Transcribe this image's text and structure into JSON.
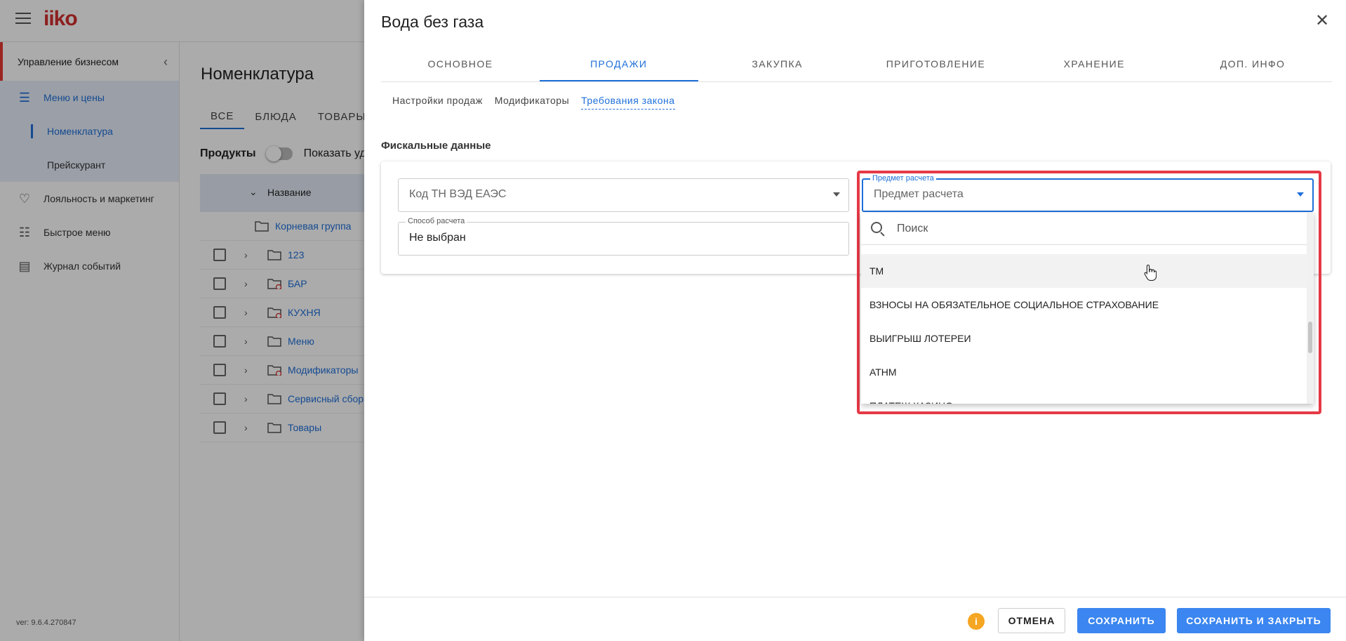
{
  "app": {
    "logo": "iiko",
    "version": "ver: 9.6.4.270847"
  },
  "sidebar": {
    "header": "Управление бизнесом",
    "items": [
      {
        "label": "Меню и цены",
        "icon": "menu-list-icon"
      },
      {
        "label": "Номенклатура"
      },
      {
        "label": "Прейскурант"
      },
      {
        "label": "Лояльность и маркетинг",
        "icon": "heart-icon"
      },
      {
        "label": "Быстрое меню",
        "icon": "quick-menu-icon"
      },
      {
        "label": "Журнал событий",
        "icon": "event-log-icon"
      }
    ]
  },
  "main": {
    "title": "Номенклатура",
    "tabs": [
      "ВСЕ",
      "БЛЮДА",
      "ТОВАРЫ"
    ],
    "products_label": "Продукты",
    "show_deleted_label": "Показать уд",
    "column_name": "Название",
    "root_group": "Корневая группа",
    "tree": [
      {
        "label": "123",
        "warn": false
      },
      {
        "label": "БАР",
        "warn": true
      },
      {
        "label": "КУХНЯ",
        "warn": true
      },
      {
        "label": "Меню",
        "warn": false
      },
      {
        "label": "Модификаторы",
        "warn": true
      },
      {
        "label": "Сервисный сбор",
        "warn": false
      },
      {
        "label": "Товары",
        "warn": false
      }
    ]
  },
  "drawer": {
    "title": "Вода без газа",
    "tabs": [
      "ОСНОВНОЕ",
      "ПРОДАЖИ",
      "ЗАКУПКА",
      "ПРИГОТОВЛЕНИЕ",
      "ХРАНЕНИЕ",
      "ДОП. ИНФО"
    ],
    "active_tab": "ПРОДАЖИ",
    "sub_tabs": [
      "Настройки продаж",
      "Модификаторы",
      "Требования закона"
    ],
    "active_sub_tab": "Требования закона",
    "section_title": "Фискальные данные",
    "fields": {
      "tnved": {
        "placeholder": "Код ТН ВЭД ЕАЭС"
      },
      "payment_method": {
        "label": "Способ расчета",
        "value": "Не выбран"
      },
      "payment_subject": {
        "label": "Предмет расчета",
        "value": "Предмет расчета"
      }
    },
    "dropdown": {
      "search_placeholder": "Поиск",
      "options": [
        "ТМ",
        "ВЗНОСЫ НА ОБЯЗАТЕЛЬНОЕ СОЦИАЛЬНОЕ СТРАХОВАНИЕ",
        "ВЫИГРЫШ ЛОТЕРЕИ",
        "АТНМ",
        "ПЛАТЕЖ КАЗИНО"
      ]
    },
    "footer": {
      "info": "i",
      "cancel": "ОТМЕНА",
      "save": "СОХРАНИТЬ",
      "save_close": "СОХРАНИТЬ И ЗАКРЫТЬ"
    }
  },
  "colors": {
    "accent": "#1e6fd9",
    "primary_button": "#3b86f0",
    "highlight": "#e53946",
    "warning": "#f5a623"
  }
}
